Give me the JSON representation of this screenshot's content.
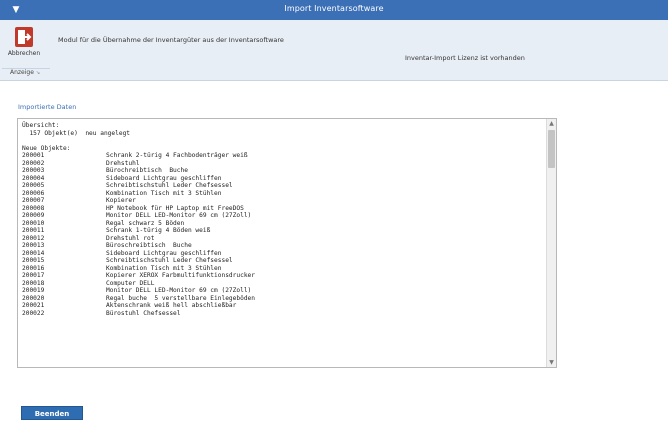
{
  "titlebar": {
    "title": "Import Inventarsoftware",
    "sys_icon": "chevron-down-icon"
  },
  "ribbon": {
    "cancel_label": "Abbrechen",
    "group_label": "Anzeige",
    "description": "Modul für die Übernahme der Inventargüter aus der Inventarsoftware",
    "status": "Inventar-Import Lizenz ist vorhanden"
  },
  "main": {
    "section_label": "Importierte Daten",
    "log": {
      "header": [
        "Übersicht:",
        "  157 Objekt(e)  neu angelegt",
        "",
        "Neue Objekte:"
      ],
      "rows": [
        [
          "200001",
          "Schrank 2-türig 4 Fachbodenträger weiß"
        ],
        [
          "200002",
          "Drehstuhl"
        ],
        [
          "200003",
          "Bürochreibtisch  Buche"
        ],
        [
          "200004",
          "Sideboard Lichtgrau geschliffen"
        ],
        [
          "200005",
          "Schreibtischstuhl Leder Chefsessel"
        ],
        [
          "200006",
          "Kombination Tisch mit 3 Stühlen"
        ],
        [
          "200007",
          "Kopierer"
        ],
        [
          "200008",
          "HP Notebook für HP Laptop mit FreeDOS"
        ],
        [
          "200009",
          "Monitor DELL LED-Monitor 69 cm (27Zoll)"
        ],
        [
          "200010",
          "Regal schwarz 5 Böden"
        ],
        [
          "200011",
          "Schrank 1-türig 4 Böden weiß"
        ],
        [
          "200012",
          "Drehstuhl rot"
        ],
        [
          "200013",
          "Büroschreibtisch  Buche"
        ],
        [
          "200014",
          "Sideboard Lichtgrau geschliffen"
        ],
        [
          "200015",
          "Schreibtischstuhl Leder Chefsessel"
        ],
        [
          "200016",
          "Kombination Tisch mit 3 Stühlen"
        ],
        [
          "200017",
          "Kopierer XEROX Farbmultifunktionsdrucker"
        ],
        [
          "200018",
          "Computer DELL"
        ],
        [
          "200019",
          "Monitor DELL LED-Monitor 69 cm (27Zoll)"
        ],
        [
          "200020",
          "Regal buche  5 verstellbare Einlegeböden"
        ],
        [
          "200021",
          "Aktenschrank weiß hell abschließbar"
        ],
        [
          "200022",
          "Bürostuhl Chefsessel"
        ]
      ]
    }
  },
  "footer": {
    "finish_label": "Beenden"
  },
  "colors": {
    "titlebar": "#3b6fb6",
    "ribbon": "#e8eef6",
    "button": "#2f6db2"
  }
}
